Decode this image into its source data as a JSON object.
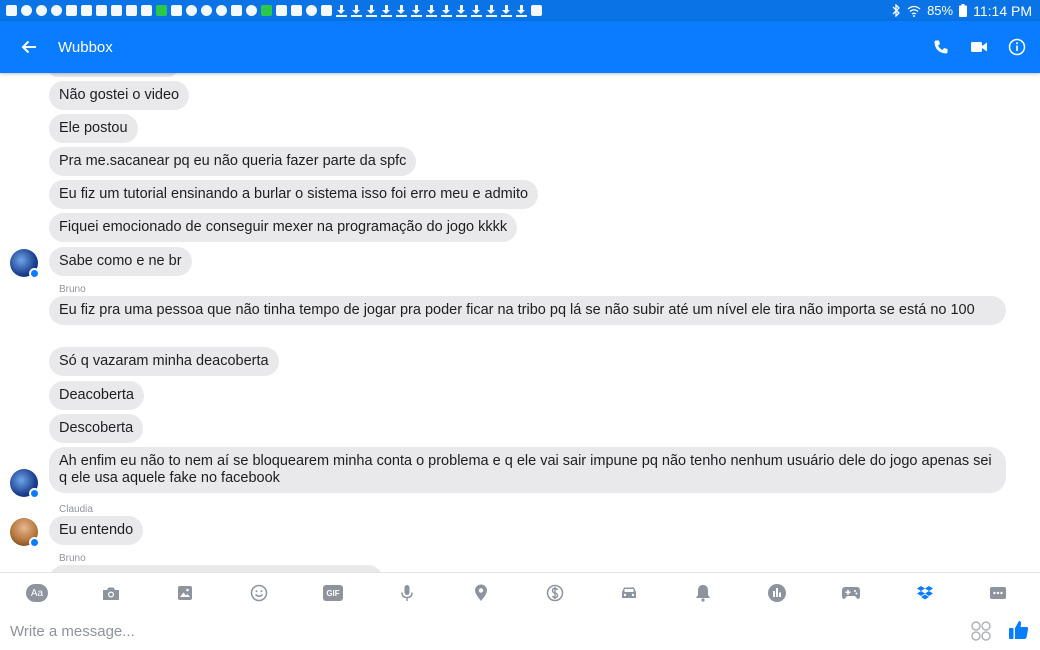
{
  "status_bar": {
    "battery": "85%",
    "time": "11:14 PM"
  },
  "header": {
    "title": "Wubbox"
  },
  "messages": [
    {
      "text": "Não gostei o video"
    },
    {
      "text": "Ele postou"
    },
    {
      "text": "Pra me.sacanear pq eu não queria fazer parte da spfc"
    },
    {
      "text": "Eu fiz um tutorial ensinando a burlar o sistema isso foi erro meu e admito"
    },
    {
      "text": "Fiquei emocionado de conseguir mexer na programação do jogo kkkk"
    },
    {
      "text": "Sabe como e ne br"
    },
    {
      "sender": "Bruno",
      "text": "Eu fiz pra uma pessoa que não tinha tempo de jogar pra poder ficar na tribo pq lá se não subir até um nível ele tira não importa se está no 100"
    },
    {
      "text": "Só q vazaram minha deacoberta"
    },
    {
      "text": "Deacoberta"
    },
    {
      "text": "Descoberta"
    },
    {
      "text": "Ah enfim eu não to nem aí se bloquearem minha conta o problema e q ele vai sair impune pq não tenho nenhum usuário dele do jogo apenas sei q ele usa aquele fake no facebook"
    },
    {
      "sender": "Claudia",
      "text": "Eu entendo"
    },
    {
      "sender": "Bruno",
      "text": ""
    }
  ],
  "toolbar": {
    "items": [
      "text-format",
      "camera",
      "gallery",
      "emoji",
      "gif",
      "microphone",
      "location",
      "payments",
      "rides",
      "reminders",
      "polls",
      "games",
      "dropbox",
      "more"
    ],
    "aa_label": "Aa",
    "gif_label": "GIF"
  },
  "composer": {
    "placeholder": "Write a message..."
  },
  "colors": {
    "brand": "#0a7cff",
    "status_bar": "#0a73e6",
    "bubble": "#e9e9eb",
    "icon_gray": "#8d949e"
  }
}
